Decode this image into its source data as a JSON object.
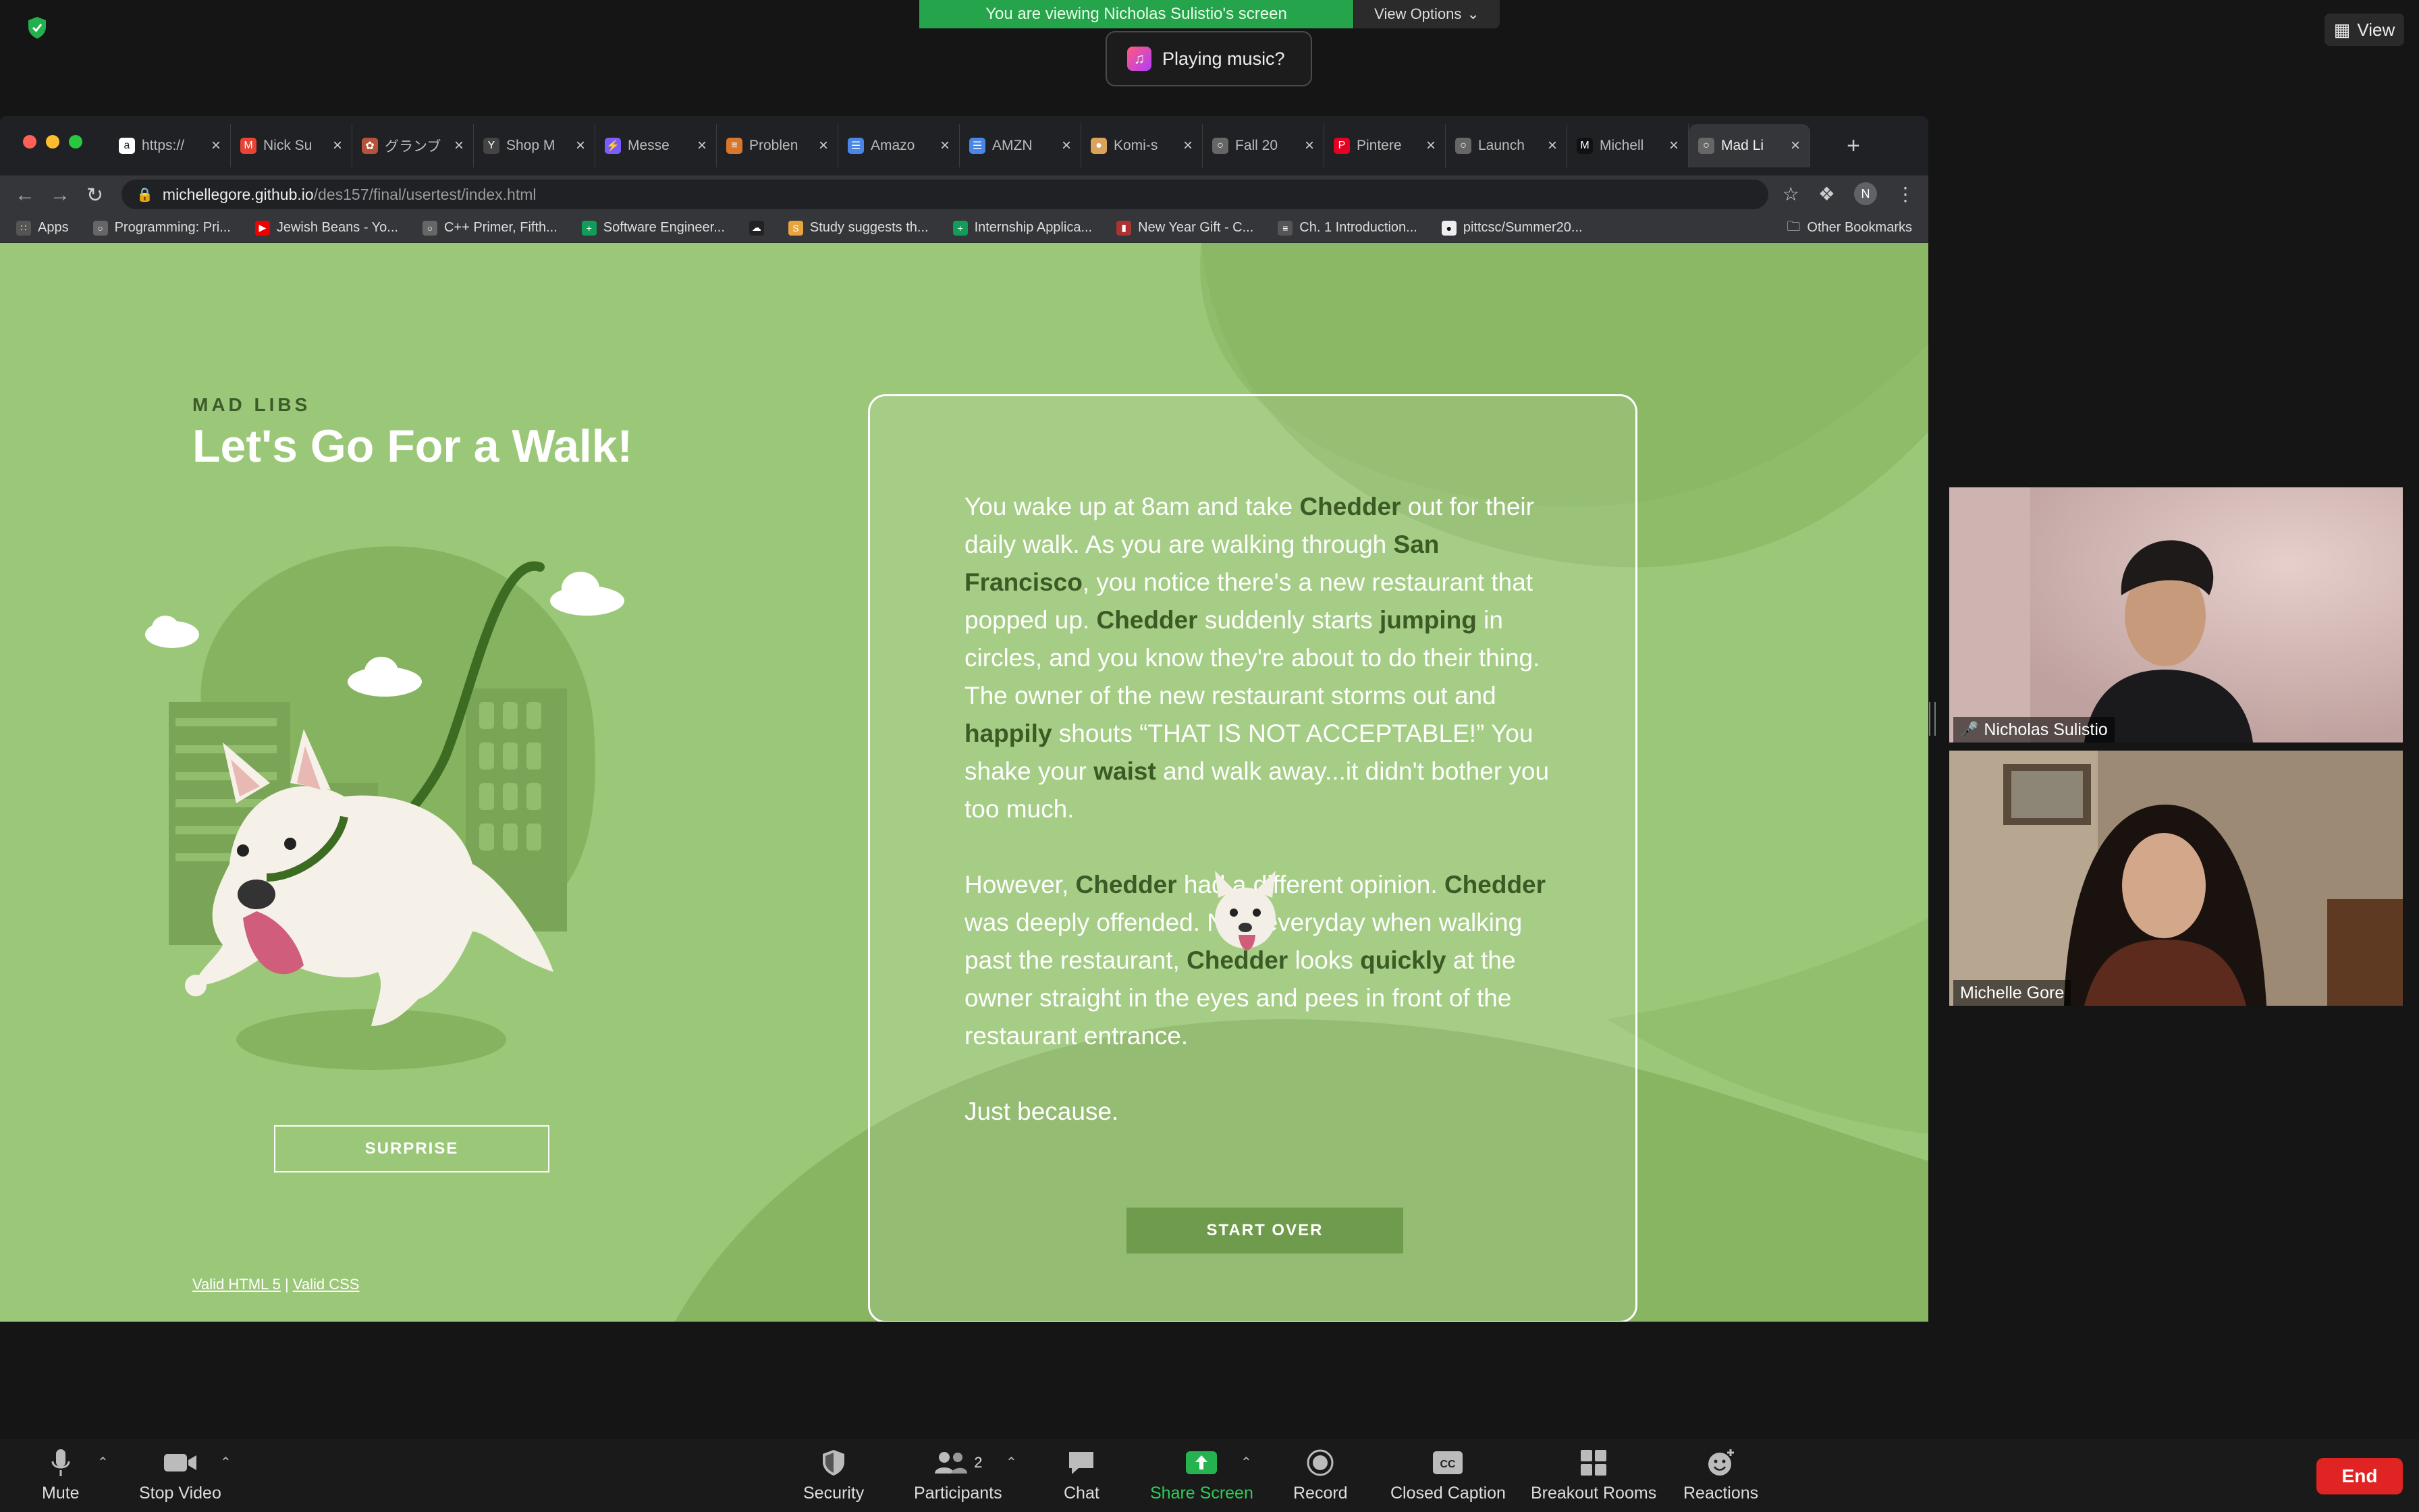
{
  "zoom": {
    "share_banner": "You are viewing Nicholas Sulistio's screen",
    "view_options": "View Options",
    "music_prompt": "Playing music?",
    "view_label": "View",
    "participants": [
      {
        "name": "Nicholas Sulistio",
        "muted": true
      },
      {
        "name": "Michelle Gore",
        "muted": false
      }
    ],
    "controls": {
      "mute": "Mute",
      "stop_video": "Stop Video",
      "security": "Security",
      "participants": "Participants",
      "participants_count": "2",
      "chat": "Chat",
      "share_screen": "Share Screen",
      "record": "Record",
      "closed_caption": "Closed Caption",
      "breakout_rooms": "Breakout Rooms",
      "reactions": "Reactions",
      "end": "End"
    },
    "colors": {
      "share_green": "#25a44c",
      "end_red": "#e02424"
    }
  },
  "browser": {
    "tabs": [
      {
        "title": "https://",
        "icon": "amazon-icon"
      },
      {
        "title": "Nick Su",
        "icon": "gmail-icon"
      },
      {
        "title": "グランブ",
        "icon": "app-icon"
      },
      {
        "title": "Shop M",
        "icon": "y-icon"
      },
      {
        "title": "Messe",
        "icon": "messenger-icon"
      },
      {
        "title": "Problen",
        "icon": "code-icon"
      },
      {
        "title": "Amazo",
        "icon": "docs-icon"
      },
      {
        "title": "AMZN",
        "icon": "docs-icon"
      },
      {
        "title": "Komi-s",
        "icon": "cake-icon"
      },
      {
        "title": "Fall 20",
        "icon": "globe-icon"
      },
      {
        "title": "Pintere",
        "icon": "pinterest-icon"
      },
      {
        "title": "Launch",
        "icon": "globe-icon"
      },
      {
        "title": "Michell",
        "icon": "m-icon"
      },
      {
        "title": "Mad Li",
        "icon": "globe-icon",
        "active": true
      }
    ],
    "url_host": "michellegore.github.io",
    "url_path": "/des157/final/usertest/index.html",
    "profile_initial": "N",
    "bookmarks": [
      {
        "label": "Apps",
        "icon": "apps-icon"
      },
      {
        "label": "Programming: Pri...",
        "icon": "globe-icon"
      },
      {
        "label": "Jewish Beans - Yo...",
        "icon": "youtube-icon"
      },
      {
        "label": "C++ Primer, Fifth...",
        "icon": "globe-icon"
      },
      {
        "label": "Software Engineer...",
        "icon": "sheets-icon"
      },
      {
        "label": "",
        "icon": "cloud-icon"
      },
      {
        "label": "Study suggests th...",
        "icon": "sp-icon"
      },
      {
        "label": "Internship Applica...",
        "icon": "sheets-icon"
      },
      {
        "label": "New Year Gift - C...",
        "icon": "bookmark-red-icon"
      },
      {
        "label": "Ch. 1 Introduction...",
        "icon": "lines-icon"
      },
      {
        "label": "pittcsc/Summer20...",
        "icon": "github-icon"
      }
    ],
    "other_bookmarks": "Other Bookmarks"
  },
  "page": {
    "kicker": "MAD LIBS",
    "title": "Let's Go For a Walk!",
    "surprise": "SURPRISE",
    "valid_html": "Valid HTML 5",
    "separator": "|",
    "valid_css": "Valid CSS",
    "story": {
      "p1": [
        {
          "t": "You wake up at 8am and take "
        },
        {
          "t": "Chedder",
          "b": true
        },
        {
          "t": " out for their daily walk. As you are walking through "
        },
        {
          "t": "San Francisco",
          "b": true
        },
        {
          "t": ", you notice there's a new restaurant that popped up. "
        },
        {
          "t": "Chedder",
          "b": true
        },
        {
          "t": " suddenly starts "
        },
        {
          "t": "jumping",
          "b": true
        },
        {
          "t": " in circles, and you know they're about to do their thing. The owner of the new restaurant storms out and "
        },
        {
          "t": "happily",
          "b": true
        },
        {
          "t": " shouts “THAT IS NOT ACCEPTABLE!” You shake your "
        },
        {
          "t": "waist",
          "b": true
        },
        {
          "t": " and walk away...it didn't bother you too much."
        }
      ],
      "p2": [
        {
          "t": "However, "
        },
        {
          "t": "Chedder",
          "b": true
        },
        {
          "t": " had a different opinion. "
        },
        {
          "t": "Chedder",
          "b": true
        },
        {
          "t": " was deeply offended. Now everyday when walking past the restaurant, "
        },
        {
          "t": "Chedder",
          "b": true
        },
        {
          "t": " looks "
        },
        {
          "t": "quickly",
          "b": true
        },
        {
          "t": " at the owner straight in the eyes and pees in front of the restaurant entrance."
        }
      ],
      "p3": [
        {
          "t": "Just because."
        }
      ]
    },
    "start_over": "START OVER",
    "colors": {
      "bg": "#9bc878",
      "accent": "#3b5a25",
      "button": "#6f9b4c"
    }
  }
}
